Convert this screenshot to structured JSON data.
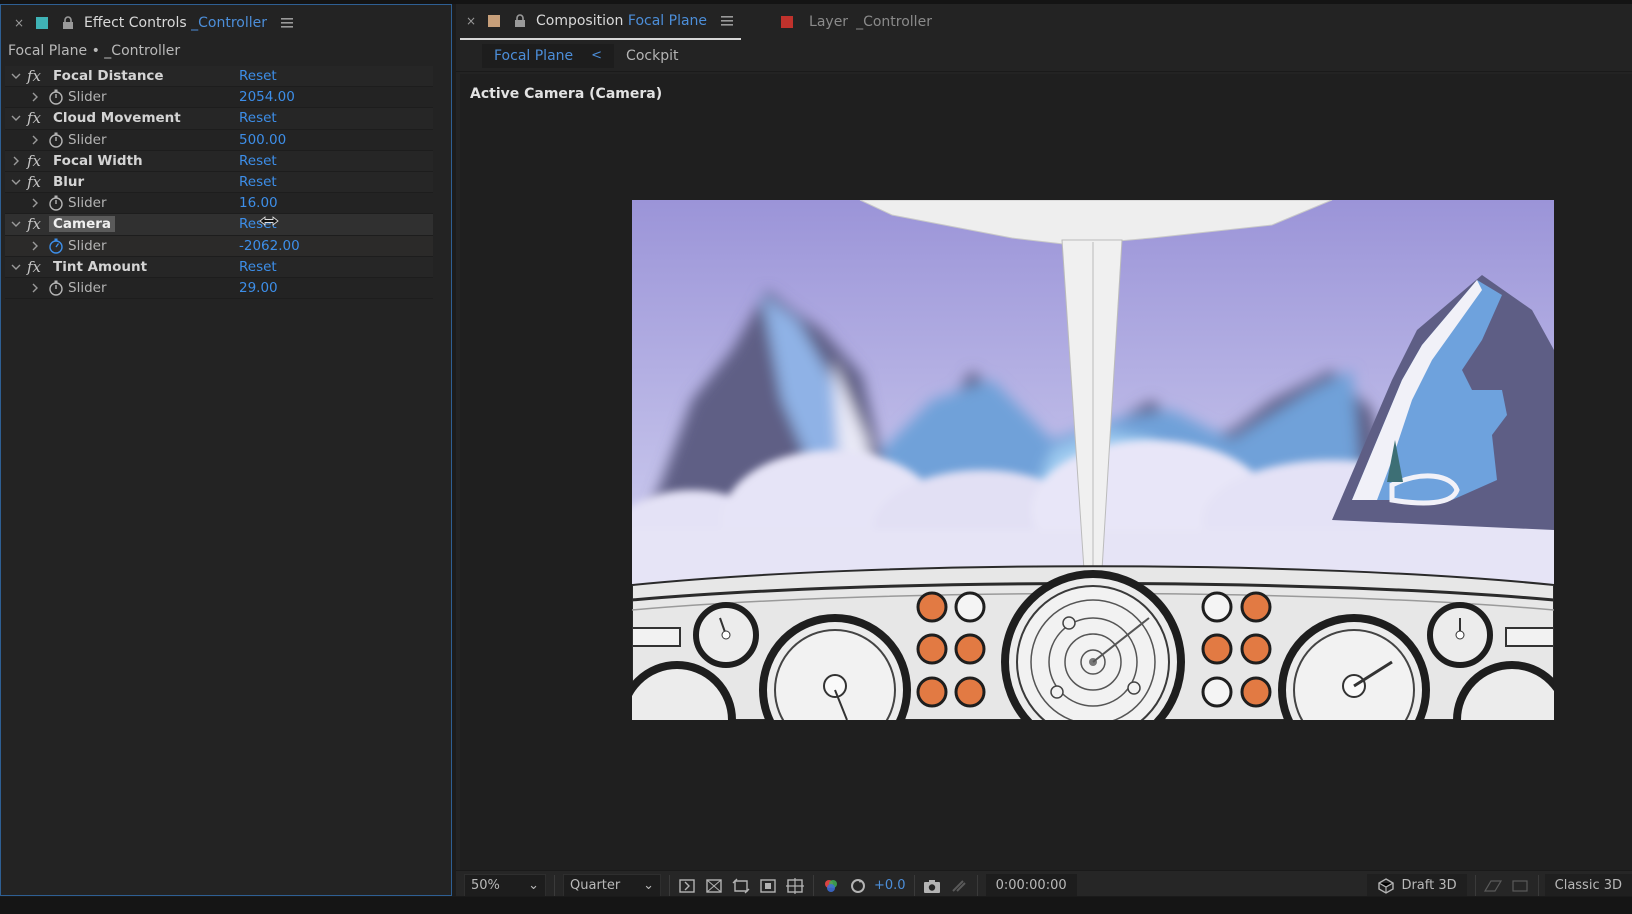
{
  "effect_controls": {
    "close_glyph": "×",
    "swatch_color": "#3fb3b6",
    "tab_prefix": "Effect Controls",
    "tab_layer": "_Controller",
    "subtitle": "Focal Plane • _Controller",
    "rows": [
      {
        "kind": "effect",
        "name": "Focal Distance",
        "value": "Reset"
      },
      {
        "kind": "prop",
        "name": "Slider",
        "value": "2054.00"
      },
      {
        "kind": "effect",
        "name": "Cloud Movement",
        "value": "Reset"
      },
      {
        "kind": "prop",
        "name": "Slider",
        "value": "500.00"
      },
      {
        "kind": "effect",
        "name": "Focal Width",
        "value": "Reset"
      },
      {
        "kind": "effect",
        "name": "Blur",
        "value": "Reset"
      },
      {
        "kind": "prop",
        "name": "Slider",
        "value": "16.00"
      },
      {
        "kind": "effect",
        "name": "Camera",
        "value": "Reset"
      },
      {
        "kind": "prop",
        "name": "Slider",
        "value": "-2062.00"
      },
      {
        "kind": "effect",
        "name": "Tint Amount",
        "value": "Reset"
      },
      {
        "kind": "prop",
        "name": "Slider",
        "value": "29.00"
      }
    ],
    "fx_glyph": "fx"
  },
  "composition": {
    "close_glyph": "×",
    "swatch_color": "#c79f7a",
    "tab_prefix": "Composition",
    "tab_name": "Focal Plane",
    "layer_tab_prefix": "Layer",
    "layer_tab_name": "_Controller",
    "layer_swatch_color": "#c0322c",
    "subtabs": {
      "active": "Focal Plane",
      "chevron": "<",
      "other": "Cockpit"
    },
    "view_label": "Active Camera (Camera)"
  },
  "toolbar": {
    "zoom": "50%",
    "resolution": "Quarter",
    "exposure": "+0.0",
    "timecode": "0:00:00:00",
    "renderer": "Draft 3D",
    "mode": "Classic 3D"
  },
  "colors": {
    "accent": "#4c8ed9",
    "value_blue": "#3d8ee8",
    "panel_border": "#2e5f93"
  }
}
